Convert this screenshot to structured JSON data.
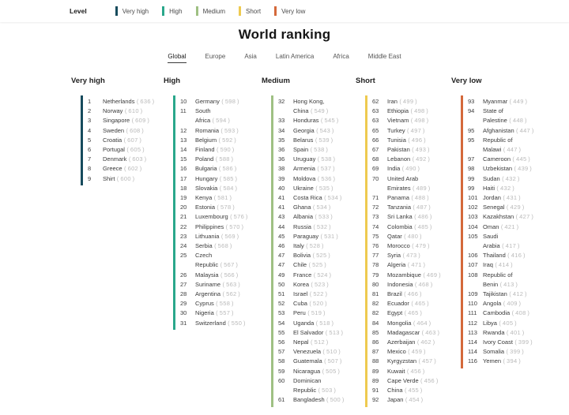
{
  "title": "World ranking",
  "legend": {
    "label": "Level",
    "items": [
      {
        "label": "Very high",
        "color": "#174b5d"
      },
      {
        "label": "High",
        "color": "#2aa78b"
      },
      {
        "label": "Medium",
        "color": "#9fc083"
      },
      {
        "label": "Short",
        "color": "#eeca50"
      },
      {
        "label": "Very low",
        "color": "#d4693b"
      }
    ]
  },
  "tabs": [
    {
      "label": "Global",
      "active": true
    },
    {
      "label": "Europe",
      "active": false
    },
    {
      "label": "Asia",
      "active": false
    },
    {
      "label": "Latin America",
      "active": false
    },
    {
      "label": "Africa",
      "active": false
    },
    {
      "label": "Middle East",
      "active": false
    }
  ],
  "columns": [
    {
      "header": "Very high",
      "color": "#174b5d",
      "rows": [
        {
          "rank": "1",
          "country": "Netherlands",
          "score": "636"
        },
        {
          "rank": "2",
          "country": "Norway",
          "score": "610"
        },
        {
          "rank": "3",
          "country": "Singapore",
          "score": "609"
        },
        {
          "rank": "4",
          "country": "Sweden",
          "score": "608"
        },
        {
          "rank": "5",
          "country": "Croatia",
          "score": "607"
        },
        {
          "rank": "6",
          "country": "Portugal",
          "score": "605"
        },
        {
          "rank": "7",
          "country": "Denmark",
          "score": "603"
        },
        {
          "rank": "8",
          "country": "Greece",
          "score": "602"
        },
        {
          "rank": "9",
          "country": "Shirt",
          "score": "600"
        }
      ]
    },
    {
      "header": "High",
      "color": "#2aa78b",
      "rows": [
        {
          "rank": "10",
          "country": "Germany",
          "score": "598"
        },
        {
          "rank": "11",
          "country": "South Africa",
          "score": "594"
        },
        {
          "rank": "12",
          "country": "Romania",
          "score": "593"
        },
        {
          "rank": "13",
          "country": "Belgium",
          "score": "592"
        },
        {
          "rank": "14",
          "country": "Finland",
          "score": "590"
        },
        {
          "rank": "15",
          "country": "Poland",
          "score": "588"
        },
        {
          "rank": "16",
          "country": "Bulgaria",
          "score": "586"
        },
        {
          "rank": "17",
          "country": "Hungary",
          "score": "585"
        },
        {
          "rank": "18",
          "country": "Slovakia",
          "score": "584"
        },
        {
          "rank": "19",
          "country": "Kenya",
          "score": "581"
        },
        {
          "rank": "20",
          "country": "Estonia",
          "score": "578"
        },
        {
          "rank": "21",
          "country": "Luxembourg",
          "score": "576"
        },
        {
          "rank": "22",
          "country": "Philippines",
          "score": "570"
        },
        {
          "rank": "23",
          "country": "Lithuania",
          "score": "569"
        },
        {
          "rank": "24",
          "country": "Serbia",
          "score": "568"
        },
        {
          "rank": "25",
          "country": "Czech Republic",
          "score": "567"
        },
        {
          "rank": "26",
          "country": "Malaysia",
          "score": "566"
        },
        {
          "rank": "27",
          "country": "Suriname",
          "score": "563"
        },
        {
          "rank": "28",
          "country": "Argentina",
          "score": "562"
        },
        {
          "rank": "29",
          "country": "Cyprus",
          "score": "558"
        },
        {
          "rank": "30",
          "country": "Nigeria",
          "score": "557"
        },
        {
          "rank": "31",
          "country": "Switzerland",
          "score": "550"
        }
      ]
    },
    {
      "header": "Medium",
      "color": "#9fc083",
      "rows": [
        {
          "rank": "32",
          "country": "Hong Kong, China",
          "score": "549"
        },
        {
          "rank": "33",
          "country": "Honduras",
          "score": "545"
        },
        {
          "rank": "34",
          "country": "Georgia",
          "score": "543"
        },
        {
          "rank": "35",
          "country": "Belarus",
          "score": "539"
        },
        {
          "rank": "36",
          "country": "Spain",
          "score": "538"
        },
        {
          "rank": "36",
          "country": "Uruguay",
          "score": "538"
        },
        {
          "rank": "38",
          "country": "Armenia",
          "score": "537"
        },
        {
          "rank": "39",
          "country": "Moldova",
          "score": "536"
        },
        {
          "rank": "40",
          "country": "Ukraine",
          "score": "535"
        },
        {
          "rank": "41",
          "country": "Costa Rica",
          "score": "534"
        },
        {
          "rank": "41",
          "country": "Ghana",
          "score": "534"
        },
        {
          "rank": "43",
          "country": "Albania",
          "score": "533"
        },
        {
          "rank": "44",
          "country": "Russia",
          "score": "532"
        },
        {
          "rank": "45",
          "country": "Paraguay",
          "score": "531"
        },
        {
          "rank": "46",
          "country": "Italy",
          "score": "528"
        },
        {
          "rank": "47",
          "country": "Bolivia",
          "score": "525"
        },
        {
          "rank": "47",
          "country": "Chile",
          "score": "525"
        },
        {
          "rank": "49",
          "country": "France",
          "score": "524"
        },
        {
          "rank": "50",
          "country": "Korea",
          "score": "523"
        },
        {
          "rank": "51",
          "country": "Israel",
          "score": "522"
        },
        {
          "rank": "52",
          "country": "Cuba",
          "score": "520"
        },
        {
          "rank": "53",
          "country": "Peru",
          "score": "519"
        },
        {
          "rank": "54",
          "country": "Uganda",
          "score": "518"
        },
        {
          "rank": "55",
          "country": "El Salvador",
          "score": "513"
        },
        {
          "rank": "56",
          "country": "Nepal",
          "score": "512"
        },
        {
          "rank": "57",
          "country": "Venezuela",
          "score": "510"
        },
        {
          "rank": "58",
          "country": "Guatemala",
          "score": "507"
        },
        {
          "rank": "59",
          "country": "Nicaragua",
          "score": "505"
        },
        {
          "rank": "60",
          "country": "Dominican Republic",
          "score": "503"
        },
        {
          "rank": "61",
          "country": "Bangladesh",
          "score": "500"
        }
      ]
    },
    {
      "header": "Short",
      "color": "#eeca50",
      "rows": [
        {
          "rank": "62",
          "country": "Iran",
          "score": "499"
        },
        {
          "rank": "63",
          "country": "Ethiopia",
          "score": "498"
        },
        {
          "rank": "63",
          "country": "Vietnam",
          "score": "498"
        },
        {
          "rank": "65",
          "country": "Turkey",
          "score": "497"
        },
        {
          "rank": "66",
          "country": "Tunisia",
          "score": "496"
        },
        {
          "rank": "67",
          "country": "Pakistan",
          "score": "493"
        },
        {
          "rank": "68",
          "country": "Lebanon",
          "score": "492"
        },
        {
          "rank": "69",
          "country": "India",
          "score": "490"
        },
        {
          "rank": "70",
          "country": "United Arab Emirates",
          "score": "489"
        },
        {
          "rank": "71",
          "country": "Panama",
          "score": "488"
        },
        {
          "rank": "72",
          "country": "Tanzania",
          "score": "487"
        },
        {
          "rank": "73",
          "country": "Sri Lanka",
          "score": "486"
        },
        {
          "rank": "74",
          "country": "Colombia",
          "score": "485"
        },
        {
          "rank": "75",
          "country": "Qatar",
          "score": "480"
        },
        {
          "rank": "76",
          "country": "Morocco",
          "score": "479"
        },
        {
          "rank": "77",
          "country": "Syria",
          "score": "473"
        },
        {
          "rank": "78",
          "country": "Algeria",
          "score": "471"
        },
        {
          "rank": "79",
          "country": "Mozambique",
          "score": "469"
        },
        {
          "rank": "80",
          "country": "Indonesia",
          "score": "468"
        },
        {
          "rank": "81",
          "country": "Brazil",
          "score": "466"
        },
        {
          "rank": "82",
          "country": "Ecuador",
          "score": "465"
        },
        {
          "rank": "82",
          "country": "Egypt",
          "score": "465"
        },
        {
          "rank": "84",
          "country": "Mongolia",
          "score": "464"
        },
        {
          "rank": "85",
          "country": "Madagascar",
          "score": "463"
        },
        {
          "rank": "86",
          "country": "Azerbaijan",
          "score": "462"
        },
        {
          "rank": "87",
          "country": "Mexico",
          "score": "459"
        },
        {
          "rank": "88",
          "country": "Kyrgyzstan",
          "score": "457"
        },
        {
          "rank": "89",
          "country": "Kuwait",
          "score": "456"
        },
        {
          "rank": "89",
          "country": "Cape Verde",
          "score": "456"
        },
        {
          "rank": "91",
          "country": "China",
          "score": "455"
        },
        {
          "rank": "92",
          "country": "Japan",
          "score": "454"
        }
      ]
    },
    {
      "header": "Very low",
      "color": "#d4693b",
      "rows": [
        {
          "rank": "93",
          "country": "Myanmar",
          "score": "449"
        },
        {
          "rank": "94",
          "country": "State of Palestine",
          "score": "448"
        },
        {
          "rank": "95",
          "country": "Afghanistan",
          "score": "447"
        },
        {
          "rank": "95",
          "country": "Republic of Malawi",
          "score": "447"
        },
        {
          "rank": "97",
          "country": "Cameroon",
          "score": "445"
        },
        {
          "rank": "98",
          "country": "Uzbekistan",
          "score": "439"
        },
        {
          "rank": "99",
          "country": "Sudan",
          "score": "432"
        },
        {
          "rank": "99",
          "country": "Haiti",
          "score": "432"
        },
        {
          "rank": "101",
          "country": "Jordan",
          "score": "431"
        },
        {
          "rank": "102",
          "country": "Senegal",
          "score": "429"
        },
        {
          "rank": "103",
          "country": "Kazakhstan",
          "score": "427"
        },
        {
          "rank": "104",
          "country": "Oman",
          "score": "421"
        },
        {
          "rank": "105",
          "country": "Saudi Arabia",
          "score": "417"
        },
        {
          "rank": "106",
          "country": "Thailand",
          "score": "416"
        },
        {
          "rank": "107",
          "country": "Iraq",
          "score": "414"
        },
        {
          "rank": "108",
          "country": "Republic of Benin",
          "score": "413"
        },
        {
          "rank": "109",
          "country": "Tajikistan",
          "score": "412"
        },
        {
          "rank": "110",
          "country": "Angola",
          "score": "409"
        },
        {
          "rank": "111",
          "country": "Cambodia",
          "score": "408"
        },
        {
          "rank": "112",
          "country": "Libya",
          "score": "405"
        },
        {
          "rank": "113",
          "country": "Rwanda",
          "score": "401"
        },
        {
          "rank": "114",
          "country": "Ivory Coast",
          "score": "399"
        },
        {
          "rank": "114",
          "country": "Somalia",
          "score": "399"
        },
        {
          "rank": "116",
          "country": "Yemen",
          "score": "394"
        }
      ]
    }
  ]
}
